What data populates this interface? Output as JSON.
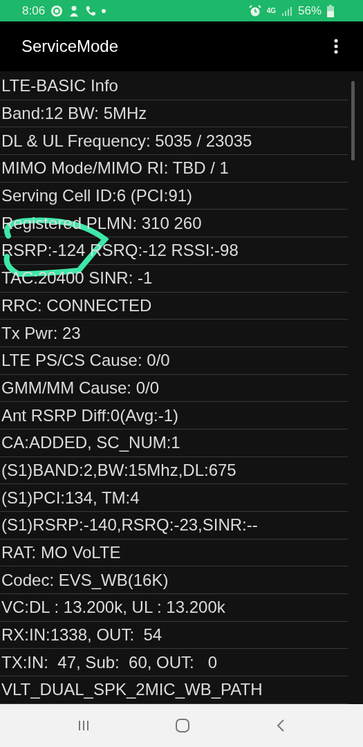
{
  "status_bar": {
    "time": "8:06",
    "network": "4G",
    "battery": "56%"
  },
  "app_bar": {
    "title": "ServiceMode"
  },
  "info_lines": [
    "LTE-BASIC Info",
    "Band:12 BW: 5MHz",
    "DL & UL Frequency: 5035 / 23035",
    "MIMO Mode/MIMO RI: TBD / 1",
    "Serving Cell ID:6 (PCI:91)",
    "Registered PLMN: 310 260",
    "RSRP:-124 RSRQ:-12 RSSI:-98",
    "TAC:20400 SINR: -1",
    "RRC: CONNECTED",
    "Tx Pwr: 23",
    "LTE PS/CS Cause: 0/0",
    "GMM/MM Cause: 0/0",
    "Ant RSRP Diff:0(Avg:-1)",
    "CA:ADDED, SC_NUM:1",
    "(S1)BAND:2,BW:15Mhz,DL:675",
    "(S1)PCI:134, TM:4",
    "(S1)RSRP:-140,RSRQ:-23,SINR:--",
    "RAT: MO VoLTE",
    "Codec: EVS_WB(16K)",
    "VC:DL : 13.200k, UL : 13.200k",
    "RX:IN:1338, OUT:  54",
    "TX:IN:  47, Sub:  60, OUT:   0",
    "VLT_DUAL_SPK_2MIC_WB_PATH"
  ]
}
